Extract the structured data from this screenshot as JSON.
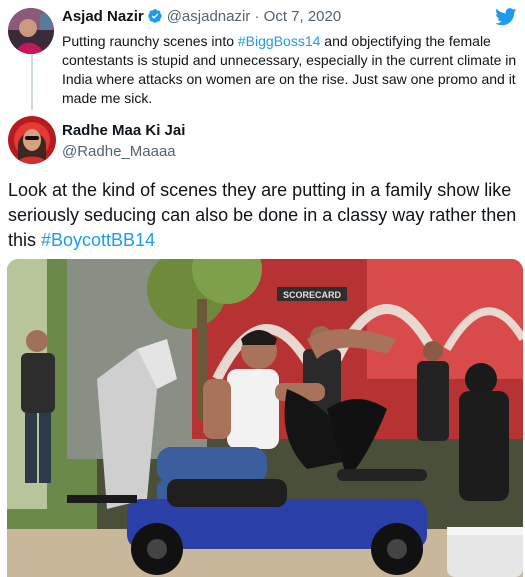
{
  "quoted_tweet": {
    "author_name": "Asjad Nazir",
    "author_handle": "@asjadnazir",
    "separator": "·",
    "date": "Oct 7, 2020",
    "text_before": "Putting raunchy scenes into ",
    "hashtag": "#BiggBoss14",
    "text_after": " and objectifying the female contestants is stupid and unnecessary, especially in the current climate in India where attacks on women are on the rise. Just saw one promo and it made me sick.",
    "verified": true
  },
  "main_tweet": {
    "author_name": "Radhe Maa Ki Jai",
    "author_handle": "@Radhe_Maaaa",
    "text_before": "Look at the kind of scenes they are putting in a family show like seriously seducing can also be done in a classy way rather then this ",
    "hashtag": "#BoycottBB14"
  },
  "photo": {
    "sign_text": "SCORECARD"
  },
  "colors": {
    "link": "#1d9bf0",
    "twitter_blue": "#1d9bf0",
    "text": "#0f1419",
    "muted": "#536471"
  },
  "icons": [
    "twitter-bird-icon",
    "verified-badge-icon"
  ]
}
